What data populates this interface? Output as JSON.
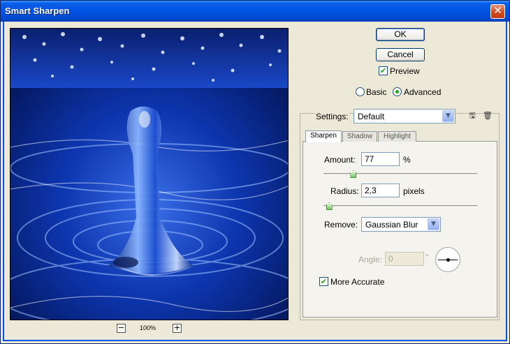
{
  "window": {
    "title": "Smart Sharpen",
    "close_glyph": "✕"
  },
  "preview": {
    "zoom_out": "−",
    "zoom_label": "100%",
    "zoom_in": "+"
  },
  "buttons": {
    "ok": "OK",
    "cancel": "Cancel"
  },
  "preview_option": {
    "label": "Preview",
    "checked": true
  },
  "mode": {
    "basic": "Basic",
    "advanced": "Advanced",
    "selected": "advanced"
  },
  "settings": {
    "label": "Settings:",
    "value": "Default",
    "save_icon": "save-settings-icon",
    "delete_icon": "trash-icon"
  },
  "tabs": [
    {
      "label": "Sharpen",
      "active": true
    },
    {
      "label": "Shadow",
      "active": false
    },
    {
      "label": "Highlight",
      "active": false
    }
  ],
  "sharpen": {
    "amount_label": "Amount:",
    "amount_value": "77",
    "amount_unit": "%",
    "amount_level": 0.193,
    "radius_label": "Radius:",
    "radius_value": "2,3",
    "radius_unit": "pixels",
    "radius_level": 0.035,
    "remove_label": "Remove:",
    "remove_value": "Gaussian Blur",
    "angle_label": "Angle:",
    "angle_value": "0",
    "angle_unit": "°",
    "more_accurate_label": "More Accurate",
    "more_accurate_checked": true
  },
  "colors": {
    "titlebar": "#0054e3",
    "water": "#0a2fa0",
    "checkmark": "#21a121"
  }
}
